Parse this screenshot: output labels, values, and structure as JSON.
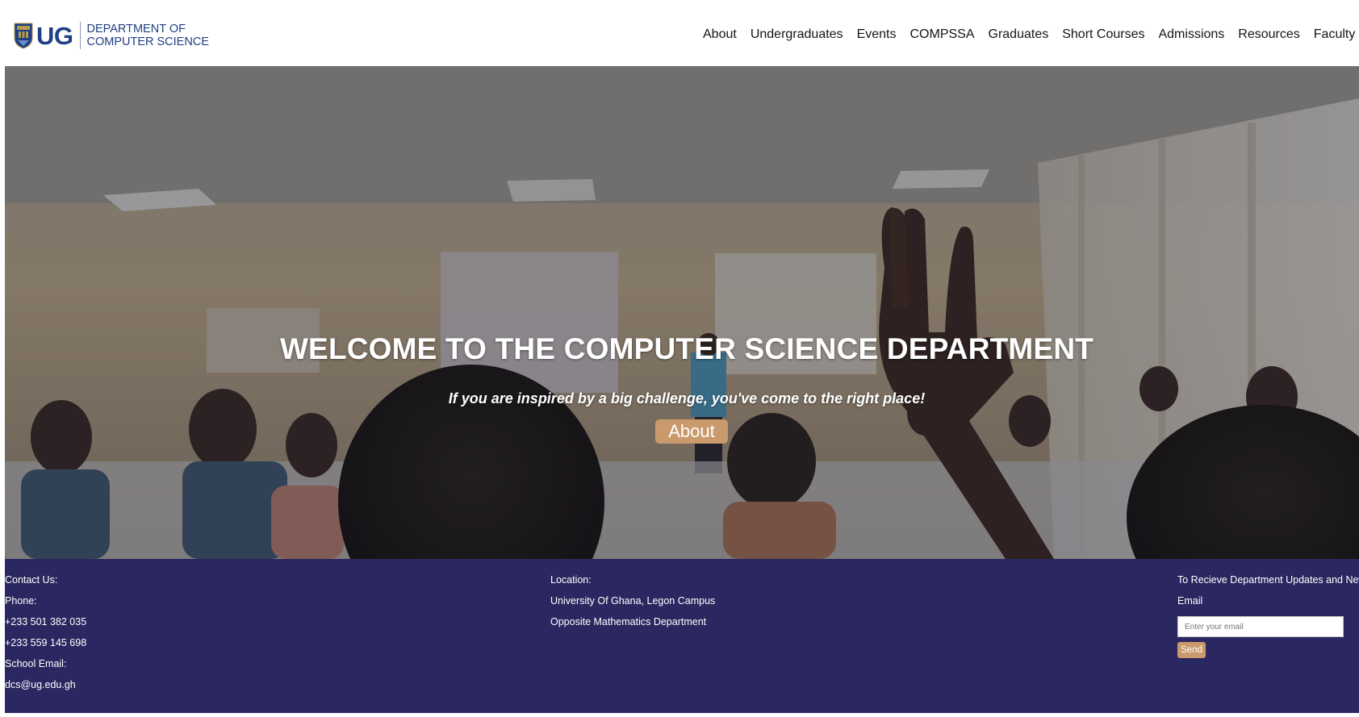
{
  "header": {
    "logo_text": "UG",
    "dept_line1": "DEPARTMENT OF",
    "dept_line2": "COMPUTER SCIENCE",
    "nav": [
      "About",
      "Undergraduates",
      "Events",
      "COMPSSA",
      "Graduates",
      "Short Courses",
      "Admissions",
      "Resources",
      "Faculty"
    ]
  },
  "hero": {
    "title": "WELCOME TO THE COMPUTER SCIENCE DEPARTMENT",
    "subtitle": "If you are inspired by a big challenge, you've come to the right place!",
    "button_label": "About"
  },
  "footer": {
    "contact": {
      "heading": "Contact Us:",
      "phone_label": "Phone:",
      "phone1": "+233 501 382 035",
      "phone2": "+233 559 145 698",
      "email_label": "School Email:",
      "email": "dcs@ug.edu.gh"
    },
    "location": {
      "heading": "Location:",
      "line1": "University Of Ghana, Legon Campus",
      "line2": "Opposite Mathematics Department"
    },
    "subscribe": {
      "heading": "To Recieve Department Updates and News",
      "email_label": "Email",
      "placeholder": "Enter your email",
      "button_label": "Send"
    }
  },
  "colors": {
    "brand_blue": "#1d3f84",
    "footer_bg": "#2b2760",
    "accent_tan": "#c99a6b"
  }
}
